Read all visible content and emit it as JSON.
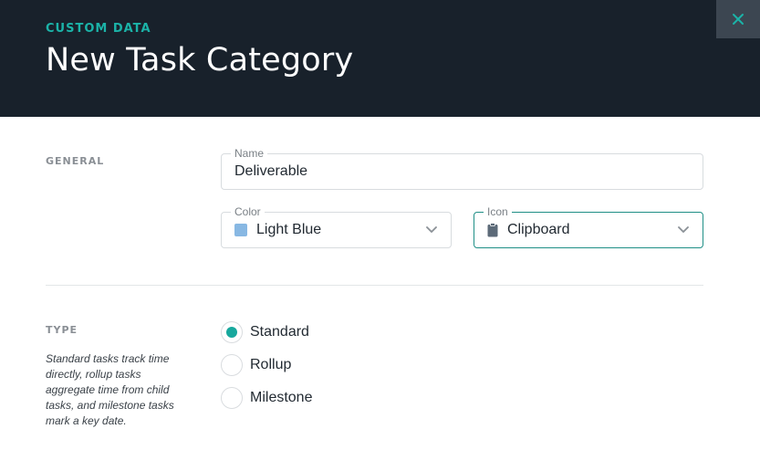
{
  "header": {
    "eyebrow": "CUSTOM DATA",
    "title": "New Task Category",
    "close_icon": "close-icon"
  },
  "general": {
    "label": "GENERAL",
    "name_field": {
      "label": "Name",
      "value": "Deliverable"
    },
    "color_field": {
      "label": "Color",
      "value": "Light Blue",
      "swatch_color": "#88b8e3"
    },
    "icon_field": {
      "label": "Icon",
      "value": "Clipboard",
      "icon": "clipboard-icon"
    }
  },
  "type": {
    "label": "TYPE",
    "description": "Standard tasks track time directly, rollup tasks aggregate time from child tasks, and milestone tasks mark a key date.",
    "options": [
      {
        "label": "Standard",
        "selected": true
      },
      {
        "label": "Rollup",
        "selected": false
      },
      {
        "label": "Milestone",
        "selected": false
      }
    ]
  },
  "colors": {
    "header_bg": "#18212b",
    "accent": "#1bb3a8",
    "radio_selected": "#17a89d"
  }
}
